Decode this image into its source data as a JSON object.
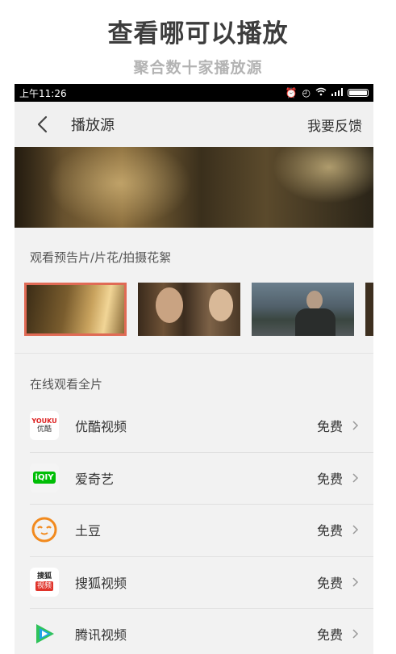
{
  "promo": {
    "title": "查看哪可以播放",
    "subtitle": "聚合数十家播放源"
  },
  "status_bar": {
    "time": "上午11:26",
    "icons": [
      "alarm-icon",
      "clock-icon",
      "wifi-icon",
      "signal-icon",
      "battery-icon"
    ]
  },
  "nav": {
    "back_icon": "chevron-left-icon",
    "title": "播放源",
    "feedback": "我要反馈"
  },
  "trailers": {
    "label": "观看预告片/片花/拍摄花絮",
    "selected_index": 0
  },
  "online": {
    "label": "在线观看全片",
    "sources": [
      {
        "name": "优酷视频",
        "price": "免费",
        "icon": "youku-icon",
        "icon_text_top": "YOUKU",
        "icon_text_bottom": "优酷"
      },
      {
        "name": "爱奇艺",
        "price": "免费",
        "icon": "iqiyi-icon",
        "icon_text": "iQIY"
      },
      {
        "name": "土豆",
        "price": "免费",
        "icon": "tudou-icon"
      },
      {
        "name": "搜狐视频",
        "price": "免费",
        "icon": "sohu-icon",
        "icon_text_top": "搜狐",
        "icon_text_bottom": "视频"
      },
      {
        "name": "腾讯视频",
        "price": "免费",
        "icon": "tencent-video-icon"
      }
    ]
  },
  "colors": {
    "selected_border": "#e06a55",
    "iqiyi_green": "#00be06",
    "tudou_orange": "#f28a1e",
    "sohu_red": "#e0342b",
    "tencent_green": "#2fc35a",
    "tencent_blue": "#1fa3e8"
  }
}
